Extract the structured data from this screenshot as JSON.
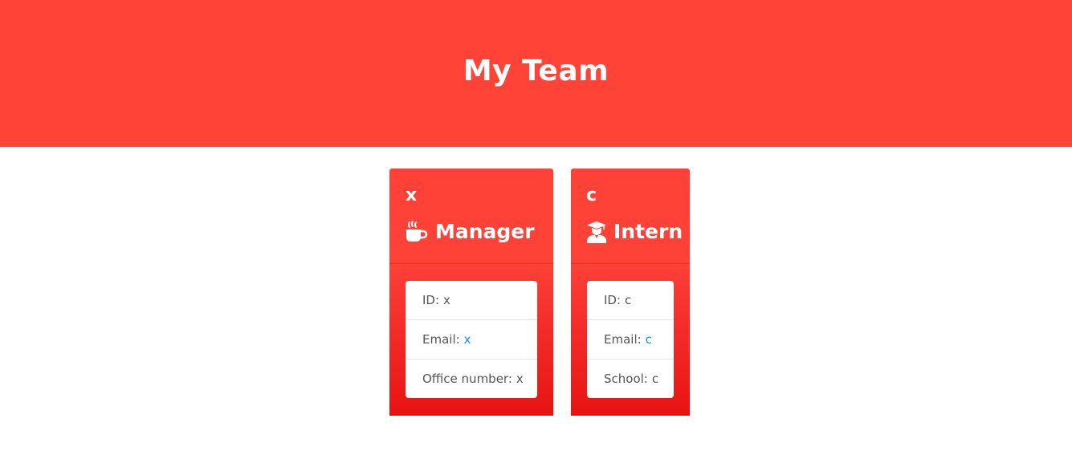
{
  "header": {
    "title": "My Team",
    "background_color": "#ff4336"
  },
  "cards": [
    {
      "name": "x",
      "role": "Manager",
      "role_icon": "coffee-mug-icon",
      "id_label": "ID:",
      "id_value": "x",
      "email_label": "Email:",
      "email_value": "x",
      "extra_label": "Office number:",
      "extra_value": "x"
    },
    {
      "name": "c",
      "role": "Intern",
      "role_icon": "graduate-user-icon",
      "id_label": "ID:",
      "id_value": "c",
      "email_label": "Email:",
      "email_value": "c",
      "extra_label": "School:",
      "extra_value": "c"
    }
  ],
  "colors": {
    "card_top": "#ff4238",
    "card_bottom": "#e81312",
    "link": "#1a8fd6",
    "text": "#555555"
  }
}
